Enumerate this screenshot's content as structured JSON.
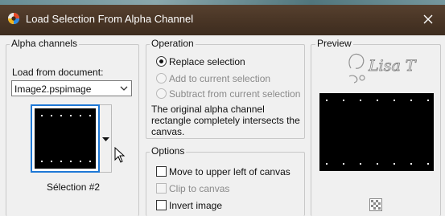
{
  "window": {
    "title": "Load Selection From Alpha Channel",
    "close_label": "✕"
  },
  "alpha_channels": {
    "group_label": "Alpha channels",
    "load_from_label": "Load from document:",
    "document_value": "Image2.pspimage",
    "selection_name": "Sélection #2"
  },
  "operation": {
    "group_label": "Operation",
    "options": [
      {
        "label": "Replace selection",
        "selected": true,
        "enabled": true
      },
      {
        "label": "Add to current selection",
        "selected": false,
        "enabled": false
      },
      {
        "label": "Subtract from current selection",
        "selected": false,
        "enabled": false
      }
    ],
    "note": "The original alpha channel rectangle completely intersects the canvas."
  },
  "options": {
    "group_label": "Options",
    "items": [
      {
        "label": "Move to upper left of canvas",
        "checked": false,
        "enabled": true
      },
      {
        "label": "Clip to canvas",
        "checked": false,
        "enabled": false
      },
      {
        "label": "Invert image",
        "checked": false,
        "enabled": true
      }
    ]
  },
  "preview": {
    "group_label": "Preview",
    "watermark_text": "Lisa T"
  },
  "icons": {
    "app": "paintshop-icon",
    "close": "close-icon",
    "dropdown": "chevron-down-icon",
    "zoom": "checkerboard-icon"
  },
  "colors": {
    "titlebar": "#4a3626",
    "selection_border": "#1e78d6",
    "thumbnail_bg": "#000000"
  }
}
